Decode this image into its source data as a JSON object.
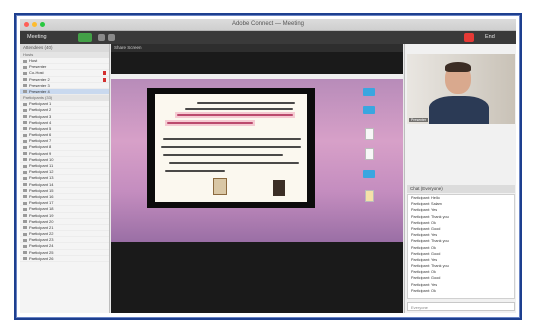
{
  "window": {
    "title": "Adobe Connect — Meeting"
  },
  "toolbar": {
    "meeting_label": "Meeting",
    "end_label": "End"
  },
  "sidebar": {
    "header": "Attendees (40)",
    "section_hosts": "Hosts",
    "section_participants": "Participants (33)",
    "hosts": [
      "Host",
      "Presenter"
    ],
    "presenters": [
      "Co-Host",
      "Presenter 2",
      "Presenter 3",
      "Presenter 4"
    ],
    "participants": [
      "Participant 1",
      "Participant 2",
      "Participant 3",
      "Participant 4",
      "Participant 5",
      "Participant 6",
      "Participant 7",
      "Participant 8",
      "Participant 9",
      "Participant 10",
      "Participant 11",
      "Participant 12",
      "Participant 13",
      "Participant 14",
      "Participant 15",
      "Participant 16",
      "Participant 17",
      "Participant 18",
      "Participant 19",
      "Participant 20",
      "Participant 21",
      "Participant 22",
      "Participant 23",
      "Participant 24",
      "Participant 25",
      "Participant 26"
    ]
  },
  "share": {
    "label": "Share Screen"
  },
  "video": {
    "name": "Presenter"
  },
  "chat": {
    "header": "Chat (Everyone)",
    "messages": [
      "Participant: Hello",
      "Participant: Salam",
      "Participant: Yes",
      "Participant: Thank you",
      "Participant: Ok",
      "Participant: Good",
      "Participant: Yes",
      "Participant: Thank you",
      "Participant: Ok",
      "Participant: Good",
      "Participant: Yes",
      "Participant: Thank you",
      "Participant: Ok",
      "Participant: Good",
      "Participant: Yes",
      "Participant: Ok"
    ],
    "input_placeholder": "Everyone"
  },
  "colors": {
    "accent": "#1d3f8f",
    "green": "#43a047",
    "red": "#e53935"
  }
}
